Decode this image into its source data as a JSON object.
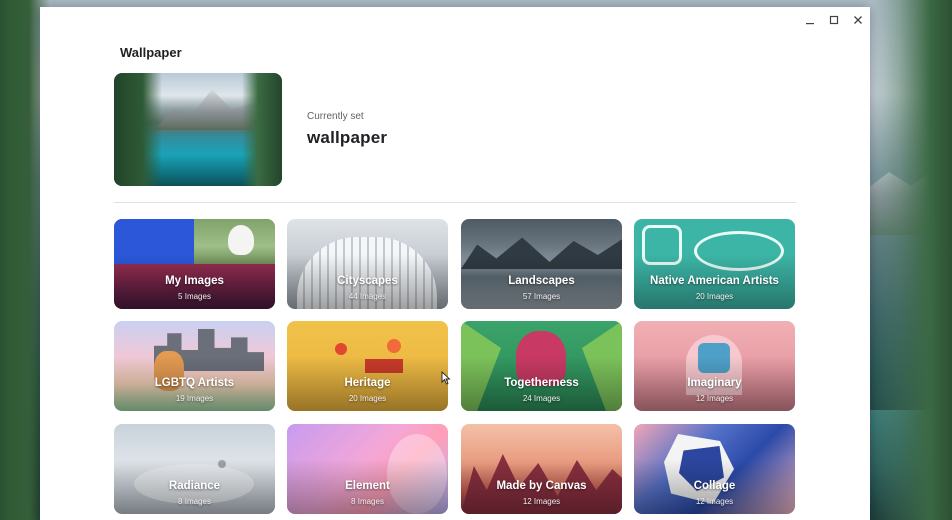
{
  "window": {
    "title": "Wallpaper",
    "controls": {
      "minimize_icon": "minimize-icon",
      "maximize_icon": "maximize-icon",
      "close_icon": "close-icon"
    }
  },
  "current": {
    "label": "Currently set",
    "name": "wallpaper"
  },
  "collections": [
    {
      "name": "My Images",
      "count": "5 Images"
    },
    {
      "name": "Cityscapes",
      "count": "44 Images"
    },
    {
      "name": "Landscapes",
      "count": "57 Images"
    },
    {
      "name": "Native American Artists",
      "count": "20 Images"
    },
    {
      "name": "LGBTQ Artists",
      "count": "19 Images"
    },
    {
      "name": "Heritage",
      "count": "20 Images"
    },
    {
      "name": "Togetherness",
      "count": "24 Images"
    },
    {
      "name": "Imaginary",
      "count": "12 Images"
    },
    {
      "name": "Radiance",
      "count": "8 Images"
    },
    {
      "name": "Element",
      "count": "8 Images"
    },
    {
      "name": "Made by Canvas",
      "count": "12 Images"
    },
    {
      "name": "Collage",
      "count": "12 Images"
    }
  ],
  "colors": {
    "window_bg": "#ffffff",
    "title_text": "#202124",
    "secondary_text": "#5f6368",
    "divider": "#e0e0e0"
  }
}
